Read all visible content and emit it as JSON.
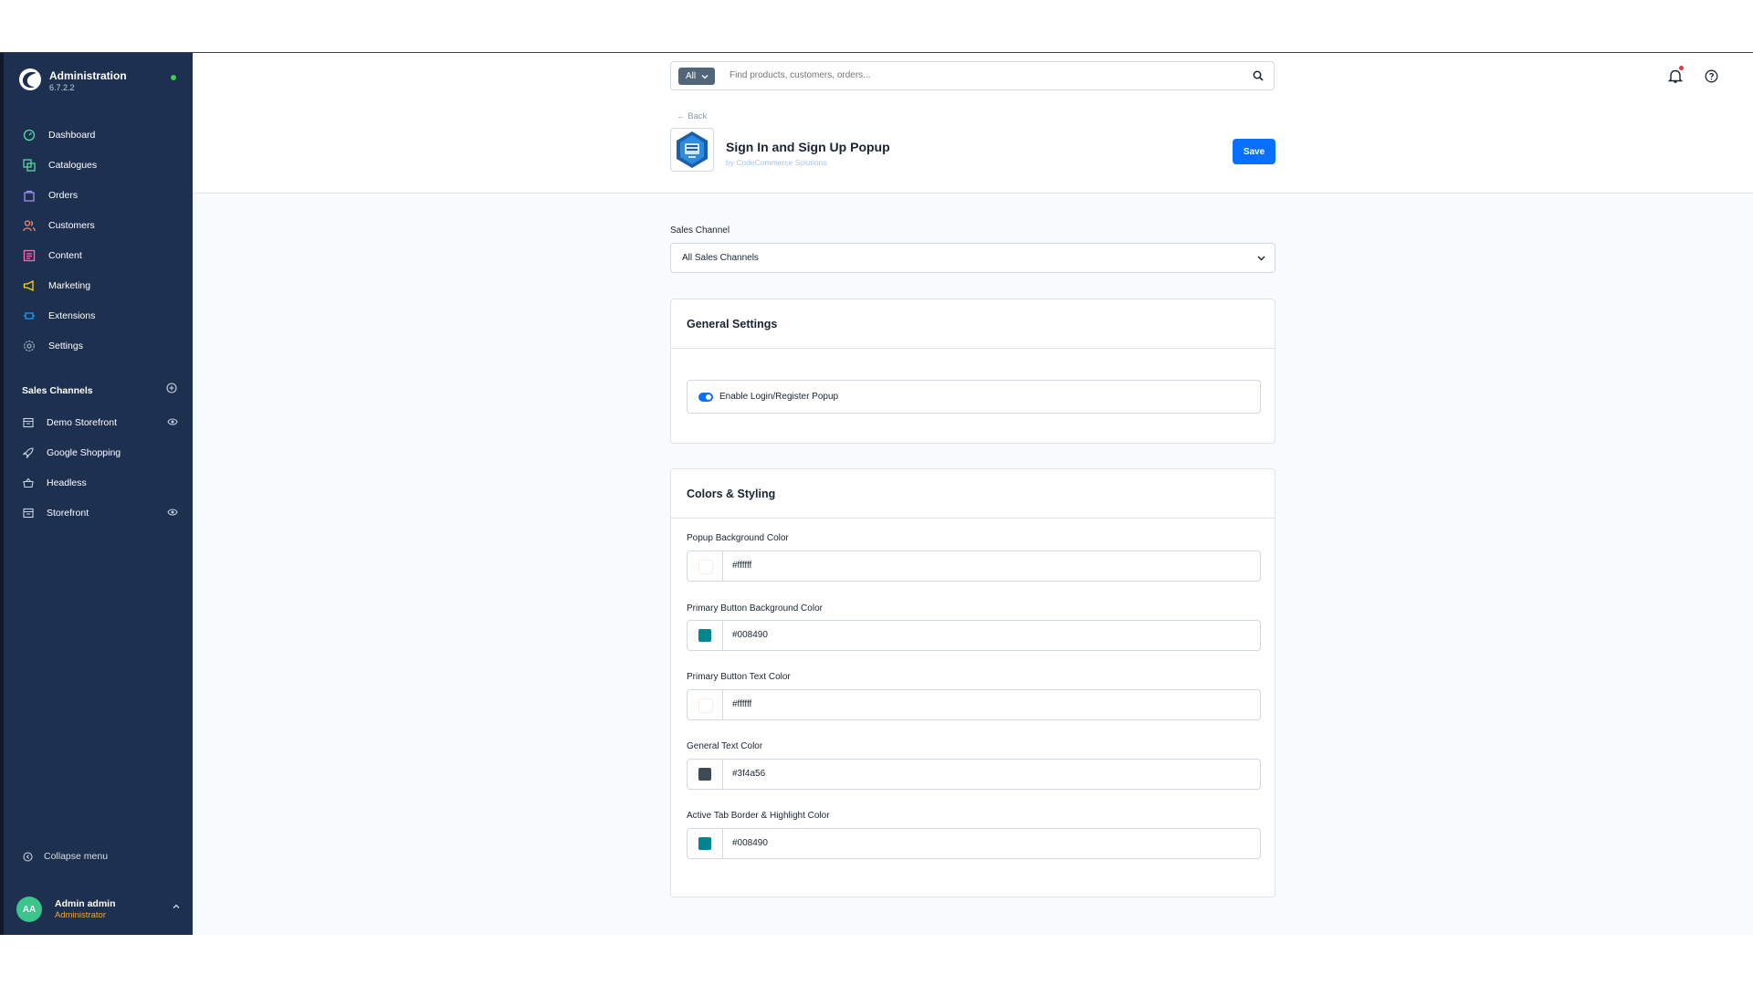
{
  "sidebar": {
    "brand_title": "Administration",
    "brand_version": "6.7.2.2",
    "nav": [
      {
        "label": "Dashboard",
        "icon": "dashboard-icon",
        "color": "#57d9a3"
      },
      {
        "label": "Catalogues",
        "icon": "catalogues-icon",
        "color": "#57d9a3"
      },
      {
        "label": "Orders",
        "icon": "orders-icon",
        "color": "#a092f0"
      },
      {
        "label": "Customers",
        "icon": "customers-icon",
        "color": "#f88962"
      },
      {
        "label": "Content",
        "icon": "content-icon",
        "color": "#ff68b4"
      },
      {
        "label": "Marketing",
        "icon": "marketing-icon",
        "color": "#ffd700"
      },
      {
        "label": "Extensions",
        "icon": "extensions-icon",
        "color": "#189eff"
      },
      {
        "label": "Settings",
        "icon": "settings-icon",
        "color": "#9aa8b5"
      }
    ],
    "sales_channels_title": "Sales Channels",
    "sales_channels": [
      {
        "label": "Demo Storefront",
        "icon": "storefront-icon",
        "eye": true
      },
      {
        "label": "Google Shopping",
        "icon": "rocket-icon",
        "eye": false
      },
      {
        "label": "Headless",
        "icon": "basket-icon",
        "eye": false
      },
      {
        "label": "Storefront",
        "icon": "storefront-icon",
        "eye": true
      }
    ],
    "collapse_label": "Collapse menu",
    "user": {
      "initials": "AA",
      "name": "Admin admin",
      "role": "Administrator"
    }
  },
  "topbar": {
    "search_scope": "All",
    "search_placeholder": "Find products, customers, orders..."
  },
  "page_header": {
    "back_label": "← Back",
    "title": "Sign In and Sign Up Popup",
    "author": "by CodeCommerce Solutions",
    "save_label": "Save"
  },
  "sales_channel": {
    "label": "Sales Channel",
    "value": "All Sales Channels"
  },
  "general_settings": {
    "title": "General Settings",
    "toggle_label": "Enable Login/Register Popup",
    "toggle_on": true
  },
  "colors_styling": {
    "title": "Colors & Styling",
    "fields": [
      {
        "label": "Popup Background Color",
        "value": "#ffffff",
        "swatch": "#ffffff"
      },
      {
        "label": "Primary Button Background Color",
        "value": "#008490",
        "swatch": "#008490"
      },
      {
        "label": "Primary Button Text Color",
        "value": "#ffffff",
        "swatch": "#ffffff"
      },
      {
        "label": "General Text Color",
        "value": "#3f4a56",
        "swatch": "#3f4a56"
      },
      {
        "label": "Active Tab Border & Highlight Color",
        "value": "#008490",
        "swatch": "#008490"
      }
    ]
  }
}
